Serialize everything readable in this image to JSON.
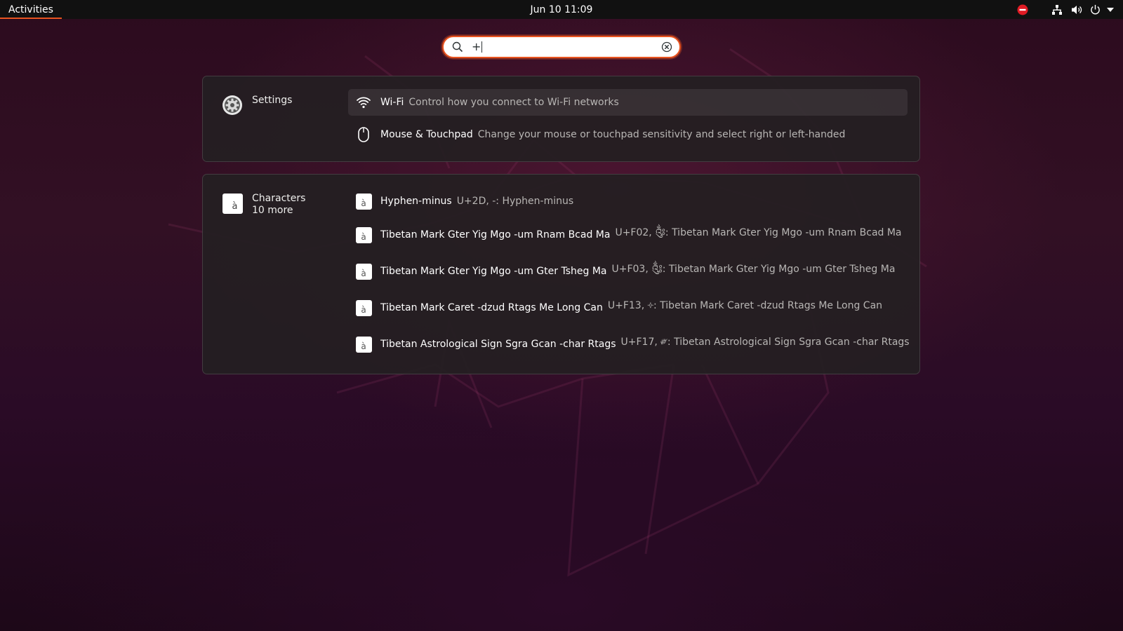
{
  "topbar": {
    "activities_label": "Activities",
    "clock": "Jun 10  11:09",
    "tray_icons": [
      "do-not-disturb-icon",
      "network-wired-icon",
      "volume-icon",
      "power-icon",
      "chevron-down-icon"
    ]
  },
  "search": {
    "query": "+",
    "clear_icon": "clear-icon",
    "search_icon": "search-icon"
  },
  "settings_provider": {
    "name": "Settings",
    "icon": "gear-icon",
    "results": [
      {
        "title": "Wi-Fi",
        "description": "Control how you connect to Wi-Fi networks",
        "icon": "wifi-icon",
        "selected": true
      },
      {
        "title": "Mouse & Touchpad",
        "description": "Change your mouse or touchpad sensitivity and select right or left-handed",
        "icon": "mouse-icon",
        "selected": false
      }
    ]
  },
  "characters_provider": {
    "name": "Characters",
    "more": "10 more",
    "icon_glyph": "à",
    "results": [
      {
        "title": "Hyphen-minus",
        "description": "U+2D, -: Hyphen-minus",
        "glyph": "à"
      },
      {
        "title": "Tibetan Mark Gter Yig Mgo -um Rnam Bcad Ma",
        "description": "U+F02, ༂: Tibetan Mark Gter Yig Mgo -um Rnam Bcad Ma",
        "glyph": "à"
      },
      {
        "title": "Tibetan Mark Gter Yig Mgo -um Gter Tsheg Ma",
        "description": "U+F03, ༃: Tibetan Mark Gter Yig Mgo -um Gter Tsheg Ma",
        "glyph": "à"
      },
      {
        "title": "Tibetan Mark Caret -dzud Rtags Me Long Can",
        "description": "U+F13, ༓: Tibetan Mark Caret -dzud Rtags Me Long Can",
        "glyph": "à"
      },
      {
        "title": "Tibetan Astrological Sign Sgra Gcan -char Rtags",
        "description": "U+F17, ༗: Tibetan Astrological Sign Sgra Gcan -char Rtags",
        "glyph": "à"
      }
    ]
  },
  "colors": {
    "accent": "#e95420",
    "topbar": "#111111",
    "panel": "#241f22"
  }
}
